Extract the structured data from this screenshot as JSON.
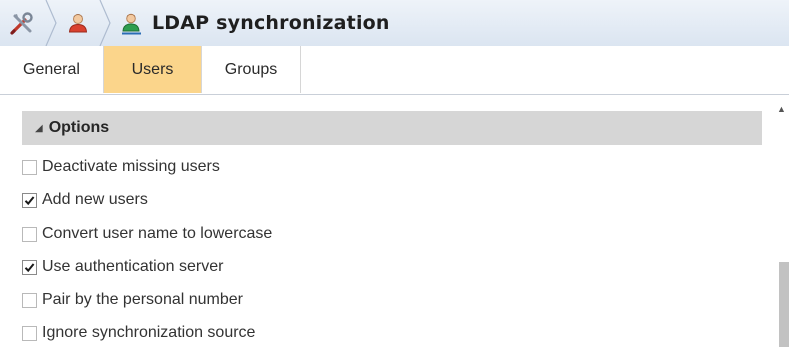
{
  "title": "LDAP synchronization",
  "breadcrumb_icons": [
    "tools-icon",
    "user-icon",
    "user-sync-icon"
  ],
  "tabs": [
    {
      "label": "General",
      "active": false
    },
    {
      "label": "Users",
      "active": true
    },
    {
      "label": "Groups",
      "active": false
    }
  ],
  "section": {
    "label": "Options",
    "expanded": true
  },
  "options": [
    {
      "label": "Deactivate missing users",
      "checked": false
    },
    {
      "label": "Add new users",
      "checked": true
    },
    {
      "label": "Convert user name to lowercase",
      "checked": false
    },
    {
      "label": "Use authentication server",
      "checked": true
    },
    {
      "label": "Pair by the personal number",
      "checked": false
    },
    {
      "label": "Ignore synchronization source",
      "checked": false
    }
  ],
  "colors": {
    "active_tab": "#fbd58b",
    "section_header": "#d6d6d6"
  }
}
